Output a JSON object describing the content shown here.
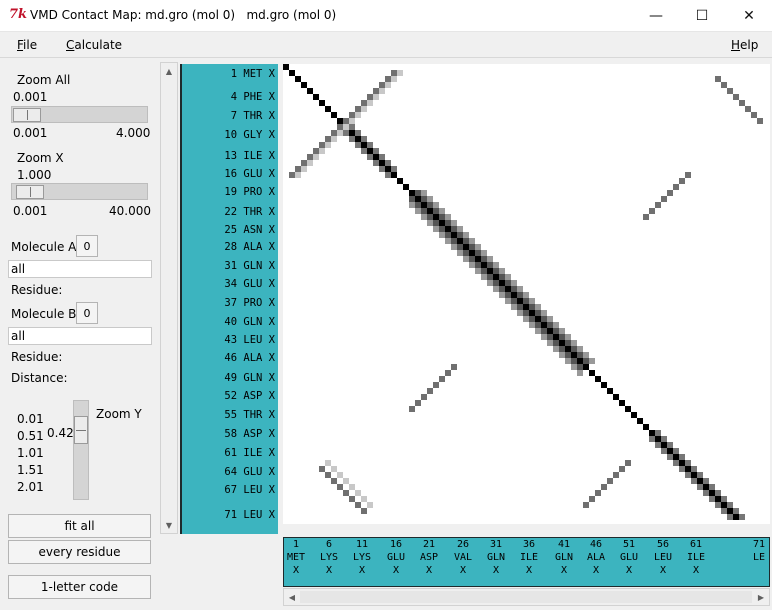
{
  "window": {
    "icon_text": "7k",
    "title": "VMD Contact Map: md.gro (mol 0)   md.gro (mol 0)",
    "min": "—",
    "max": "☐",
    "close": "✕"
  },
  "menu": {
    "file_u": "F",
    "file_rest": "ile",
    "calc_u": "C",
    "calc_rest": "alculate",
    "help_u": "H",
    "help_rest": "elp"
  },
  "controls": {
    "zoom_all_label": "Zoom All",
    "zoom_all_value": "0.001",
    "zoom_all_level": 0.0,
    "zoom_all_min": "0.001",
    "zoom_all_max": "4.000",
    "zoom_x_label": "Zoom X",
    "zoom_x_value": "1.000",
    "zoom_x_level": 0.025,
    "zoom_x_min": "0.001",
    "zoom_x_max": "40.000",
    "molecule_a_label": "Molecule A:",
    "molecule_a_value": "0",
    "selection_a": "all",
    "residue_a_label": "Residue:",
    "molecule_b_label": "Molecule B:",
    "molecule_b_value": "0",
    "selection_b": "all",
    "residue_b_label": "Residue:",
    "distance_label": "Distance:",
    "zoom_y_label": "Zoom Y",
    "zoom_y_value": "0.42",
    "zoom_y_ticks": [
      "0.01",
      "0.51",
      "1.01",
      "1.51",
      "2.01"
    ],
    "fit_all": "fit all",
    "every_residue": "every residue",
    "one_letter": "1-letter code"
  },
  "residue_rows": [
    "1 MET X",
    "4 PHE X",
    "7 THR X",
    "10 GLY X",
    "13 ILE X",
    "16 GLU X",
    "19 PRO X",
    "22 THR X",
    "25 ASN X",
    "28 ALA X",
    "31 GLN X",
    "34 GLU X",
    "37 PRO X",
    "40 GLN X",
    "43 LEU X",
    "46 ALA X",
    "49 GLN X",
    "52 ASP X",
    "55 THR X",
    "58 ASP X",
    "61 ILE X",
    "64 GLU X",
    "67 LEU X",
    "71 LEU X"
  ],
  "columns": [
    {
      "num": "1",
      "res": "MET",
      "ch": "X"
    },
    {
      "num": "6",
      "res": "LYS",
      "ch": "X"
    },
    {
      "num": "11",
      "res": "LYS",
      "ch": "X"
    },
    {
      "num": "16",
      "res": "GLU",
      "ch": "X"
    },
    {
      "num": "21",
      "res": "ASP",
      "ch": "X"
    },
    {
      "num": "26",
      "res": "VAL",
      "ch": "X"
    },
    {
      "num": "31",
      "res": "GLN",
      "ch": "X"
    },
    {
      "num": "36",
      "res": "ILE",
      "ch": "X"
    },
    {
      "num": "41",
      "res": "GLN",
      "ch": "X"
    },
    {
      "num": "46",
      "res": "ALA",
      "ch": "X"
    },
    {
      "num": "51",
      "res": "GLU",
      "ch": "X"
    },
    {
      "num": "56",
      "res": "LEU",
      "ch": "X"
    },
    {
      "num": "61",
      "res": "ILE",
      "ch": "X"
    },
    {
      "num": "71",
      "res": "LE",
      "ch": ""
    }
  ],
  "colors": {
    "list_bg": "#3cb4bf",
    "contact_dark": "#000000",
    "contact_mid": "#707070",
    "contact_light": "#c8c8c8"
  }
}
